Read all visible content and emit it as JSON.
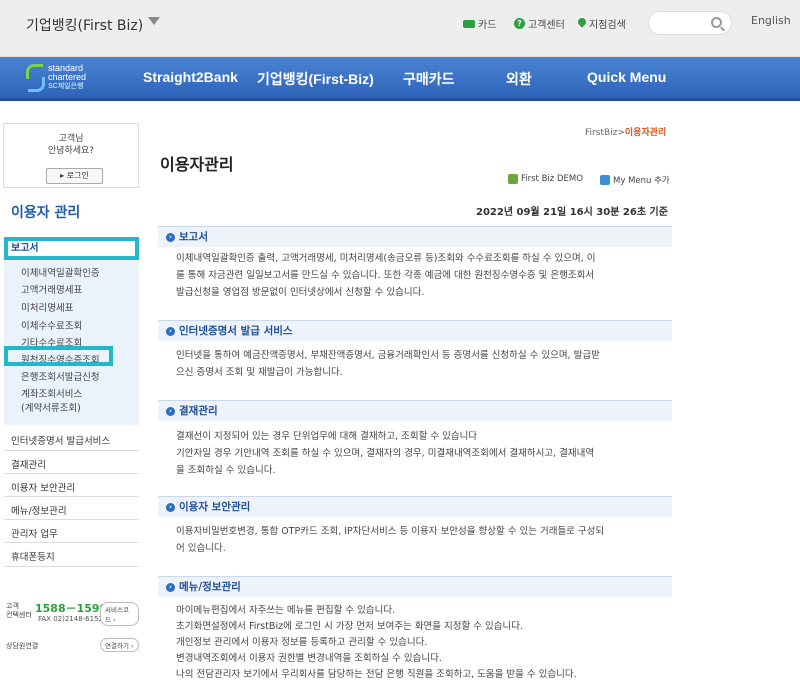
{
  "topbar": {
    "site_title": "기업뱅킹(First Biz)",
    "card": "카드",
    "customer_center": "고객센터",
    "branch_search": "지점검색",
    "language": "English"
  },
  "nav": {
    "logo_line1": "standard",
    "logo_line2": "chartered",
    "logo_line3": "SC제일은행",
    "items": [
      "Straight2Bank",
      "기업뱅킹(First-Biz)",
      "구매카드",
      "외환",
      "Quick Menu"
    ]
  },
  "sidebar": {
    "greeting_line1": "고객님",
    "greeting_line2": "안녕하세요?",
    "login_label": "로그인",
    "heading": "이용자 관리",
    "active_group": "보고서",
    "sub_items": [
      "이체내역일괄확인증",
      "고액거래명세표",
      "미처리명세표",
      "이체수수료조회",
      "기타수수료조회",
      "원천징수영수증조회",
      "은행조회서발급신청",
      "계좌조회서비스",
      "(계약서류조회)"
    ],
    "groups": [
      "인터넷증명서 발급서비스",
      "결재관리",
      "이용자 보안관리",
      "메뉴/정보관리",
      "관리자 업무",
      "휴대폰등지"
    ],
    "cs_label1": "고객",
    "cs_label2": "컨택센터",
    "cs_phone": "1588－1599",
    "cs_fax": "FAX 02)2148-6152",
    "cs_service_btn": "서비스코드 ›",
    "cs_consult": "상담원연결",
    "cs_connect_btn": "연결하기 ›"
  },
  "main": {
    "breadcrumb_root": "FirstBiz",
    "breadcrumb_sep": ">",
    "breadcrumb_current": "이용자관리",
    "title": "이용자관리",
    "demo_link": "First Biz DEMO",
    "mymenu_link": "My Menu 추가",
    "datetime": "2022년 09월 21일 16시 30분 26초 기준",
    "sections": [
      {
        "title": "보고서",
        "lines": [
          "이체내역일괄확인증 출력, 고액거래명세, 미처리명세(송금오류 등)조회와 수수료조회를 하실 수 있으며, 이",
          "를 통해 자금관련 일일보고서를 만드실 수 있습니다. 또한 각종 예금에 대한 원천징수영수증 및 은행조회서",
          "발급신청을 영업점 방문없이 인터넷상에서 신청할 수 있습니다."
        ]
      },
      {
        "title": "인터넷증명서 발급 서비스",
        "lines": [
          "인터넷을 통하여 예금잔액증명서, 부채잔액증명서, 금융거래확인서 등 증명서를 신청하실 수 있으며, 발급받",
          "으신 증명서 조회 및 재발급이 가능합니다."
        ]
      },
      {
        "title": "결재관리",
        "lines": [
          "결재선이 지정되어 있는 경우 단위업무에 대해 결재하고, 조회할 수 있습니다",
          "기안자일 경우 기안내역 조회를 하실 수 있으며, 결재자의 경우, 미결재내역조회에서 결재하시고, 결재내역",
          "을 조회하실 수 있습니다."
        ]
      },
      {
        "title": "이용자 보안관리",
        "lines": [
          "이용자비밀번호변경, 통합 OTP카드 조회, IP차단서비스 등 이용자 보안성을 향상할 수 있는 거래들로 구성되",
          "어 있습니다."
        ]
      },
      {
        "title": "메뉴/정보관리",
        "lines": [
          "마이메뉴편집에서 자주쓰는 메뉴를 편집할 수 있습니다.",
          "초기화면설정에서 FirstBiz에 로그인 시 가장 먼저 보여주는 화면을 지정할 수 있습니다.",
          "개인정보 관리에서 이용자 정보를 등록하고 관리할 수 있습니다.",
          "변경내역조회에서 이용자 권한별 변경내역을 조회하실 수 있습니다.",
          "나의 전담관리자 보기에서 우리회사를 담당하는 전담 은행 직원을 조회하고, 도움을 받을 수 있습니다."
        ]
      }
    ]
  }
}
